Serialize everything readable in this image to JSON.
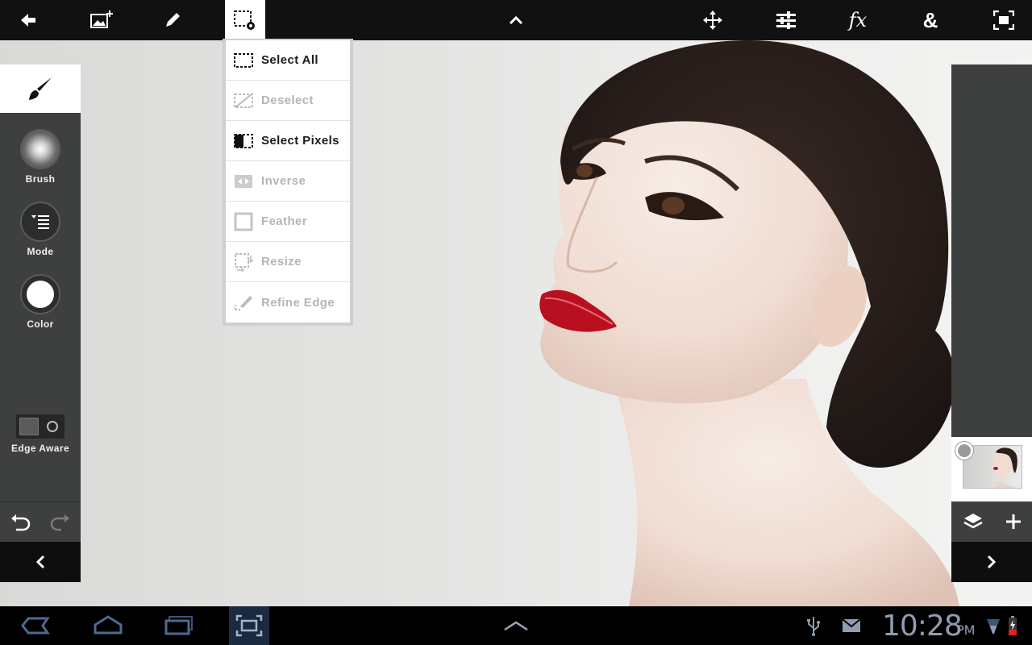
{
  "toolbar": {
    "buttons": [
      {
        "name": "back-icon"
      },
      {
        "name": "add-image-icon"
      },
      {
        "name": "pencil-icon"
      },
      {
        "name": "selection-settings-icon",
        "active": true
      },
      {
        "name": "chevron-up-icon"
      },
      {
        "name": "move-icon"
      },
      {
        "name": "adjustments-icon"
      },
      {
        "name": "fx-icon",
        "text": "fx"
      },
      {
        "name": "ampersand-icon",
        "text": "&"
      },
      {
        "name": "fullscreen-icon"
      }
    ]
  },
  "selection_menu": {
    "items": [
      {
        "label": "Select All",
        "enabled": true,
        "icon": "select-all-icon"
      },
      {
        "label": "Deselect",
        "enabled": false,
        "icon": "deselect-icon"
      },
      {
        "label": "Select Pixels",
        "enabled": true,
        "icon": "select-pixels-icon"
      },
      {
        "label": "Inverse",
        "enabled": false,
        "icon": "inverse-icon"
      },
      {
        "label": "Feather",
        "enabled": false,
        "icon": "feather-icon"
      },
      {
        "label": "Resize",
        "enabled": false,
        "icon": "resize-icon"
      },
      {
        "label": "Refine Edge",
        "enabled": false,
        "icon": "refine-edge-icon"
      }
    ]
  },
  "left_panel": {
    "active_tool": "brush-icon",
    "tools": [
      {
        "label": "Brush",
        "icon": "brush-preview-icon"
      },
      {
        "label": "Mode",
        "icon": "mode-menu-icon"
      },
      {
        "label": "Color",
        "icon": "color-swatch-icon",
        "color": "#ffffff"
      }
    ],
    "edge_aware_label": "Edge Aware",
    "edge_aware_on": false
  },
  "right_panel": {
    "layer_selected": true
  },
  "system_bar": {
    "time": "10:28",
    "ampm": "PM"
  },
  "colors": {
    "toolbar_bg": "#111111",
    "panel_bg": "#3e3f3f",
    "clock_color": "#8f9db1",
    "system_active_bg": "#1c2a3f"
  }
}
